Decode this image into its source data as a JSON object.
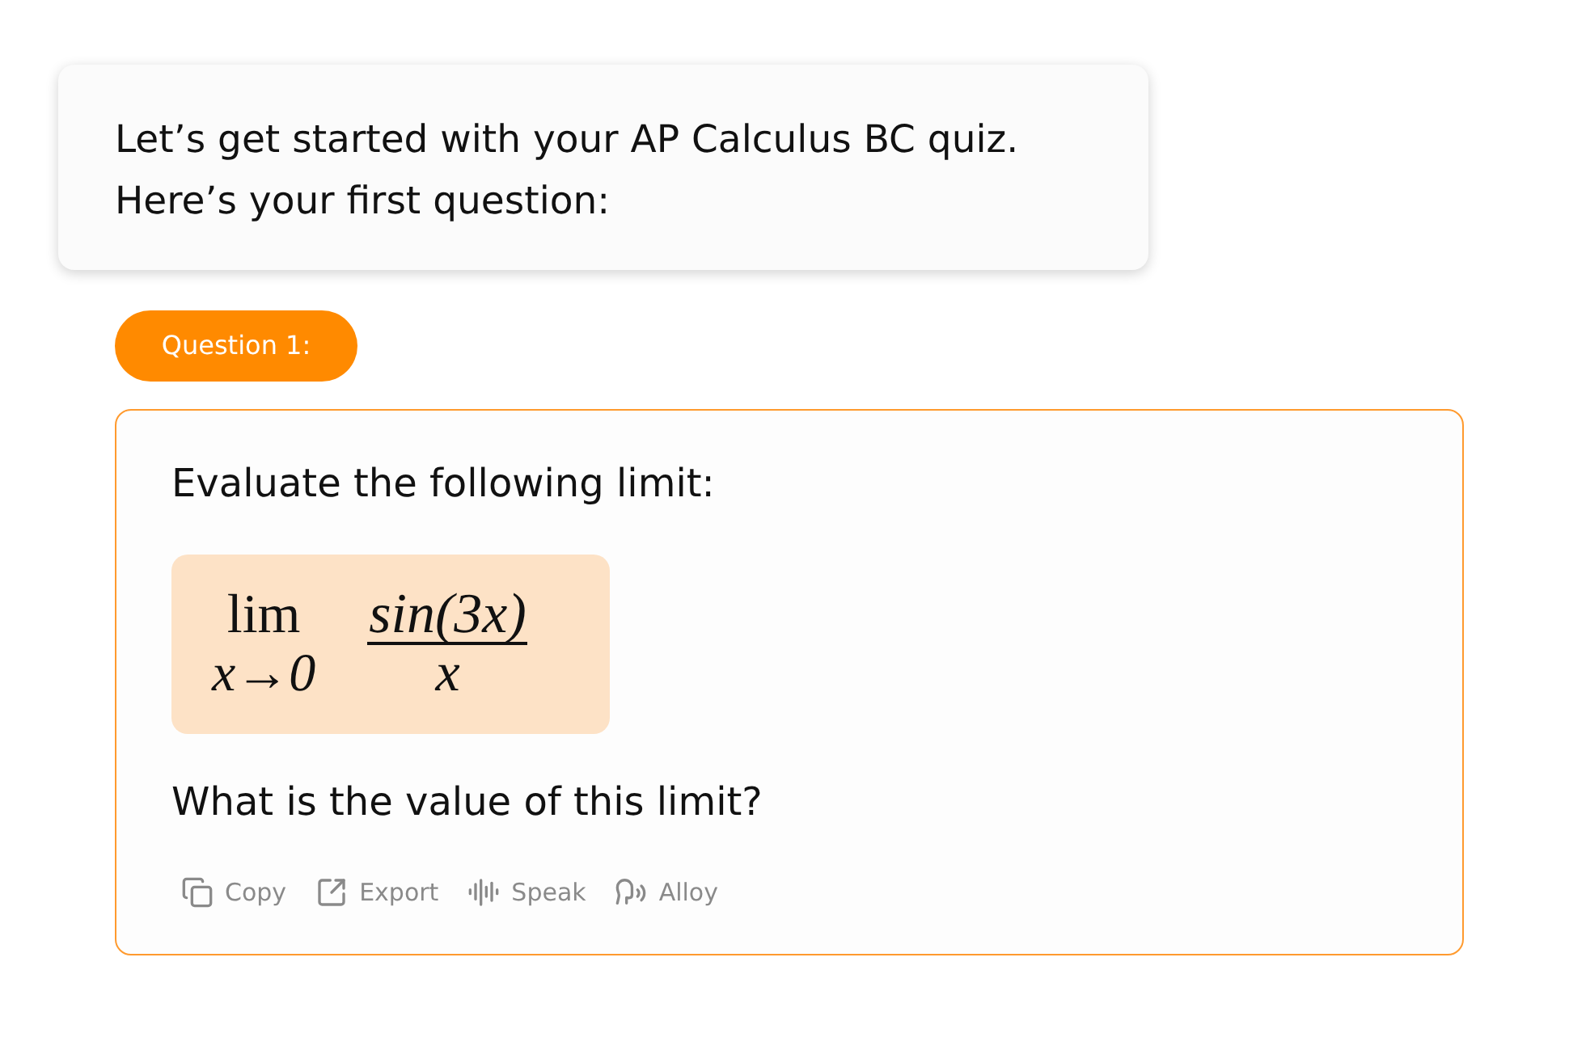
{
  "message": {
    "lines": [
      "Let’s get started with your AP Calculus BC quiz.",
      "Here’s your first question:"
    ]
  },
  "question": {
    "badge": "Question 1:",
    "prompt": "Evaluate the following limit:",
    "formula": {
      "operator": "lim",
      "subscript": "x→0",
      "numerator": "sin(3x)",
      "denominator": "x"
    },
    "followup": "What is the value of this limit?",
    "actions": [
      {
        "kind": "copy",
        "label": "Copy"
      },
      {
        "kind": "export",
        "label": "Export"
      },
      {
        "kind": "speak",
        "label": "Speak"
      },
      {
        "kind": "voice",
        "label": "Alloy"
      }
    ]
  }
}
